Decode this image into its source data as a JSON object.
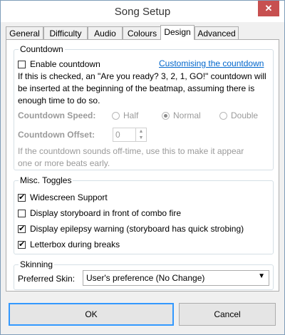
{
  "window": {
    "title": "Song Setup",
    "close_symbol": "✕"
  },
  "tabs": [
    "General",
    "Difficulty",
    "Audio",
    "Colours",
    "Design",
    "Advanced"
  ],
  "countdown": {
    "group_label": "Countdown",
    "enable_label": "Enable countdown",
    "enable_checked": false,
    "link_text": "Customising the countdown",
    "description_lines": [
      "If this is checked, an \"Are you ready? 3, 2, 1, GO!\" countdown will",
      "be inserted at the beginning of the beatmap, assuming there is",
      "enough time to do so."
    ],
    "speed_label": "Countdown Speed:",
    "speed_options": [
      "Half",
      "Normal",
      "Double"
    ],
    "speed_selected": "Normal",
    "offset_label": "Countdown Offset:",
    "offset_value": "0",
    "hint_lines": [
      "If the countdown sounds off-time, use this to make it appear",
      "one or more beats early."
    ]
  },
  "misc": {
    "group_label": "Misc. Toggles",
    "items": [
      {
        "label": "Widescreen Support",
        "checked": true
      },
      {
        "label": "Display storyboard in front of combo fire",
        "checked": false
      },
      {
        "label": "Display epilepsy warning (storyboard has quick strobing)",
        "checked": true
      },
      {
        "label": "Letterbox during breaks",
        "checked": true
      }
    ]
  },
  "skinning": {
    "group_label": "Skinning",
    "preferred_label": "Preferred Skin:",
    "selected_value": "User's preference (No Change)"
  },
  "footer": {
    "ok_label": "OK",
    "cancel_label": "Cancel"
  }
}
